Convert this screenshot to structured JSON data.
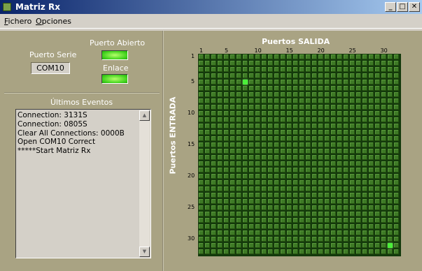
{
  "window": {
    "title": "Matriz Rx",
    "minimize": "_",
    "maximize": "□",
    "close": "✕"
  },
  "menu": [
    {
      "label": "Fichero",
      "underline": "F",
      "rest": "ichero"
    },
    {
      "label": "Opciones",
      "underline": "O",
      "rest": "pciones"
    }
  ],
  "status": {
    "puerto_serie_label": "Puerto Serie",
    "puerto_serie_value": "COM10",
    "puerto_abierto_label": "Puerto Abierto",
    "enlace_label": "Enlace",
    "puerto_abierto_on": true,
    "enlace_on": true
  },
  "events": {
    "title": "Últimos Eventos",
    "items": [
      "Connection: 3131S",
      "Connection: 0805S",
      "Clear All Connections: 0000B",
      "Open COM10 Correct",
      "*****Start Matriz Rx"
    ]
  },
  "matrix": {
    "title": "Puertos SALIDA",
    "side_label": "Puertos ENTRADA",
    "size": 32,
    "col_ticks": [
      "1",
      "5",
      "10",
      "15",
      "20",
      "25",
      "30"
    ],
    "row_ticks": [
      "1",
      "5",
      "10",
      "15",
      "20",
      "25",
      "30"
    ],
    "active": [
      {
        "row": 5,
        "col": 8
      },
      {
        "row": 31,
        "col": 31
      }
    ],
    "colors": {
      "off": "#3e7a26",
      "on": "#4cf03a",
      "background": "#143a0c"
    }
  },
  "colors": {
    "panel": "#a9a383",
    "led": "#3fd21c",
    "titlebar": "#0a246a"
  }
}
